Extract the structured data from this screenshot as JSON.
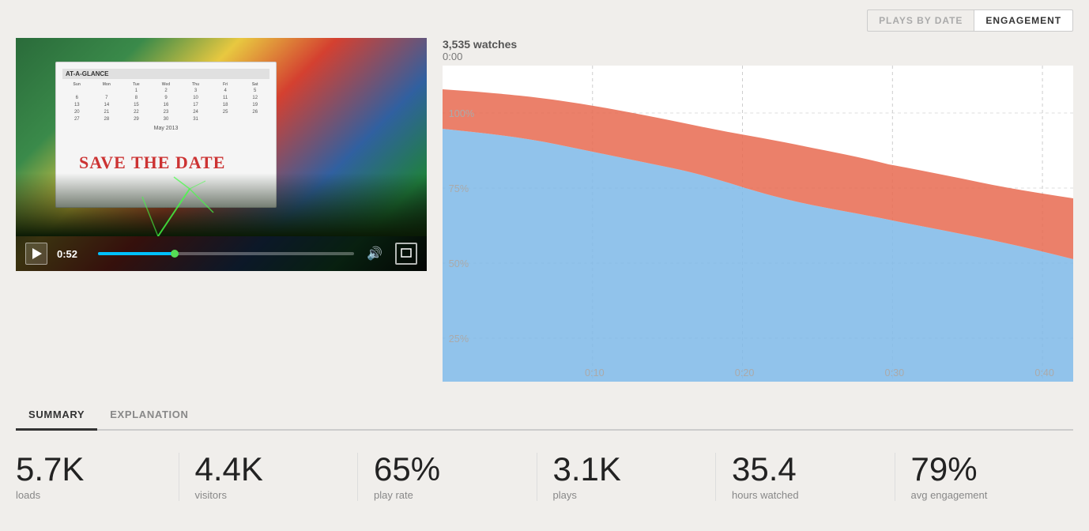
{
  "tabs": {
    "plays_by_date": "PLAYS BY DATE",
    "engagement": "ENGAGEMENT",
    "active_tab": "engagement"
  },
  "chart": {
    "watches_label": "3,535 watches",
    "time_label": "0:00",
    "y_axis": [
      "100%",
      "75%",
      "50%",
      "25%"
    ],
    "x_axis": [
      "0:10",
      "0:20",
      "0:30",
      "0:40"
    ]
  },
  "video": {
    "time_display": "0:52"
  },
  "summary": {
    "tab_summary": "SUMMARY",
    "tab_explanation": "EXPLANATION",
    "stats": [
      {
        "value": "5.7K",
        "label": "loads"
      },
      {
        "value": "4.4K",
        "label": "visitors"
      },
      {
        "value": "65%",
        "label": "play rate"
      },
      {
        "value": "3.1K",
        "label": "plays"
      },
      {
        "value": "35.4",
        "label": "hours watched"
      },
      {
        "value": "79%",
        "label": "avg engagement"
      }
    ]
  }
}
